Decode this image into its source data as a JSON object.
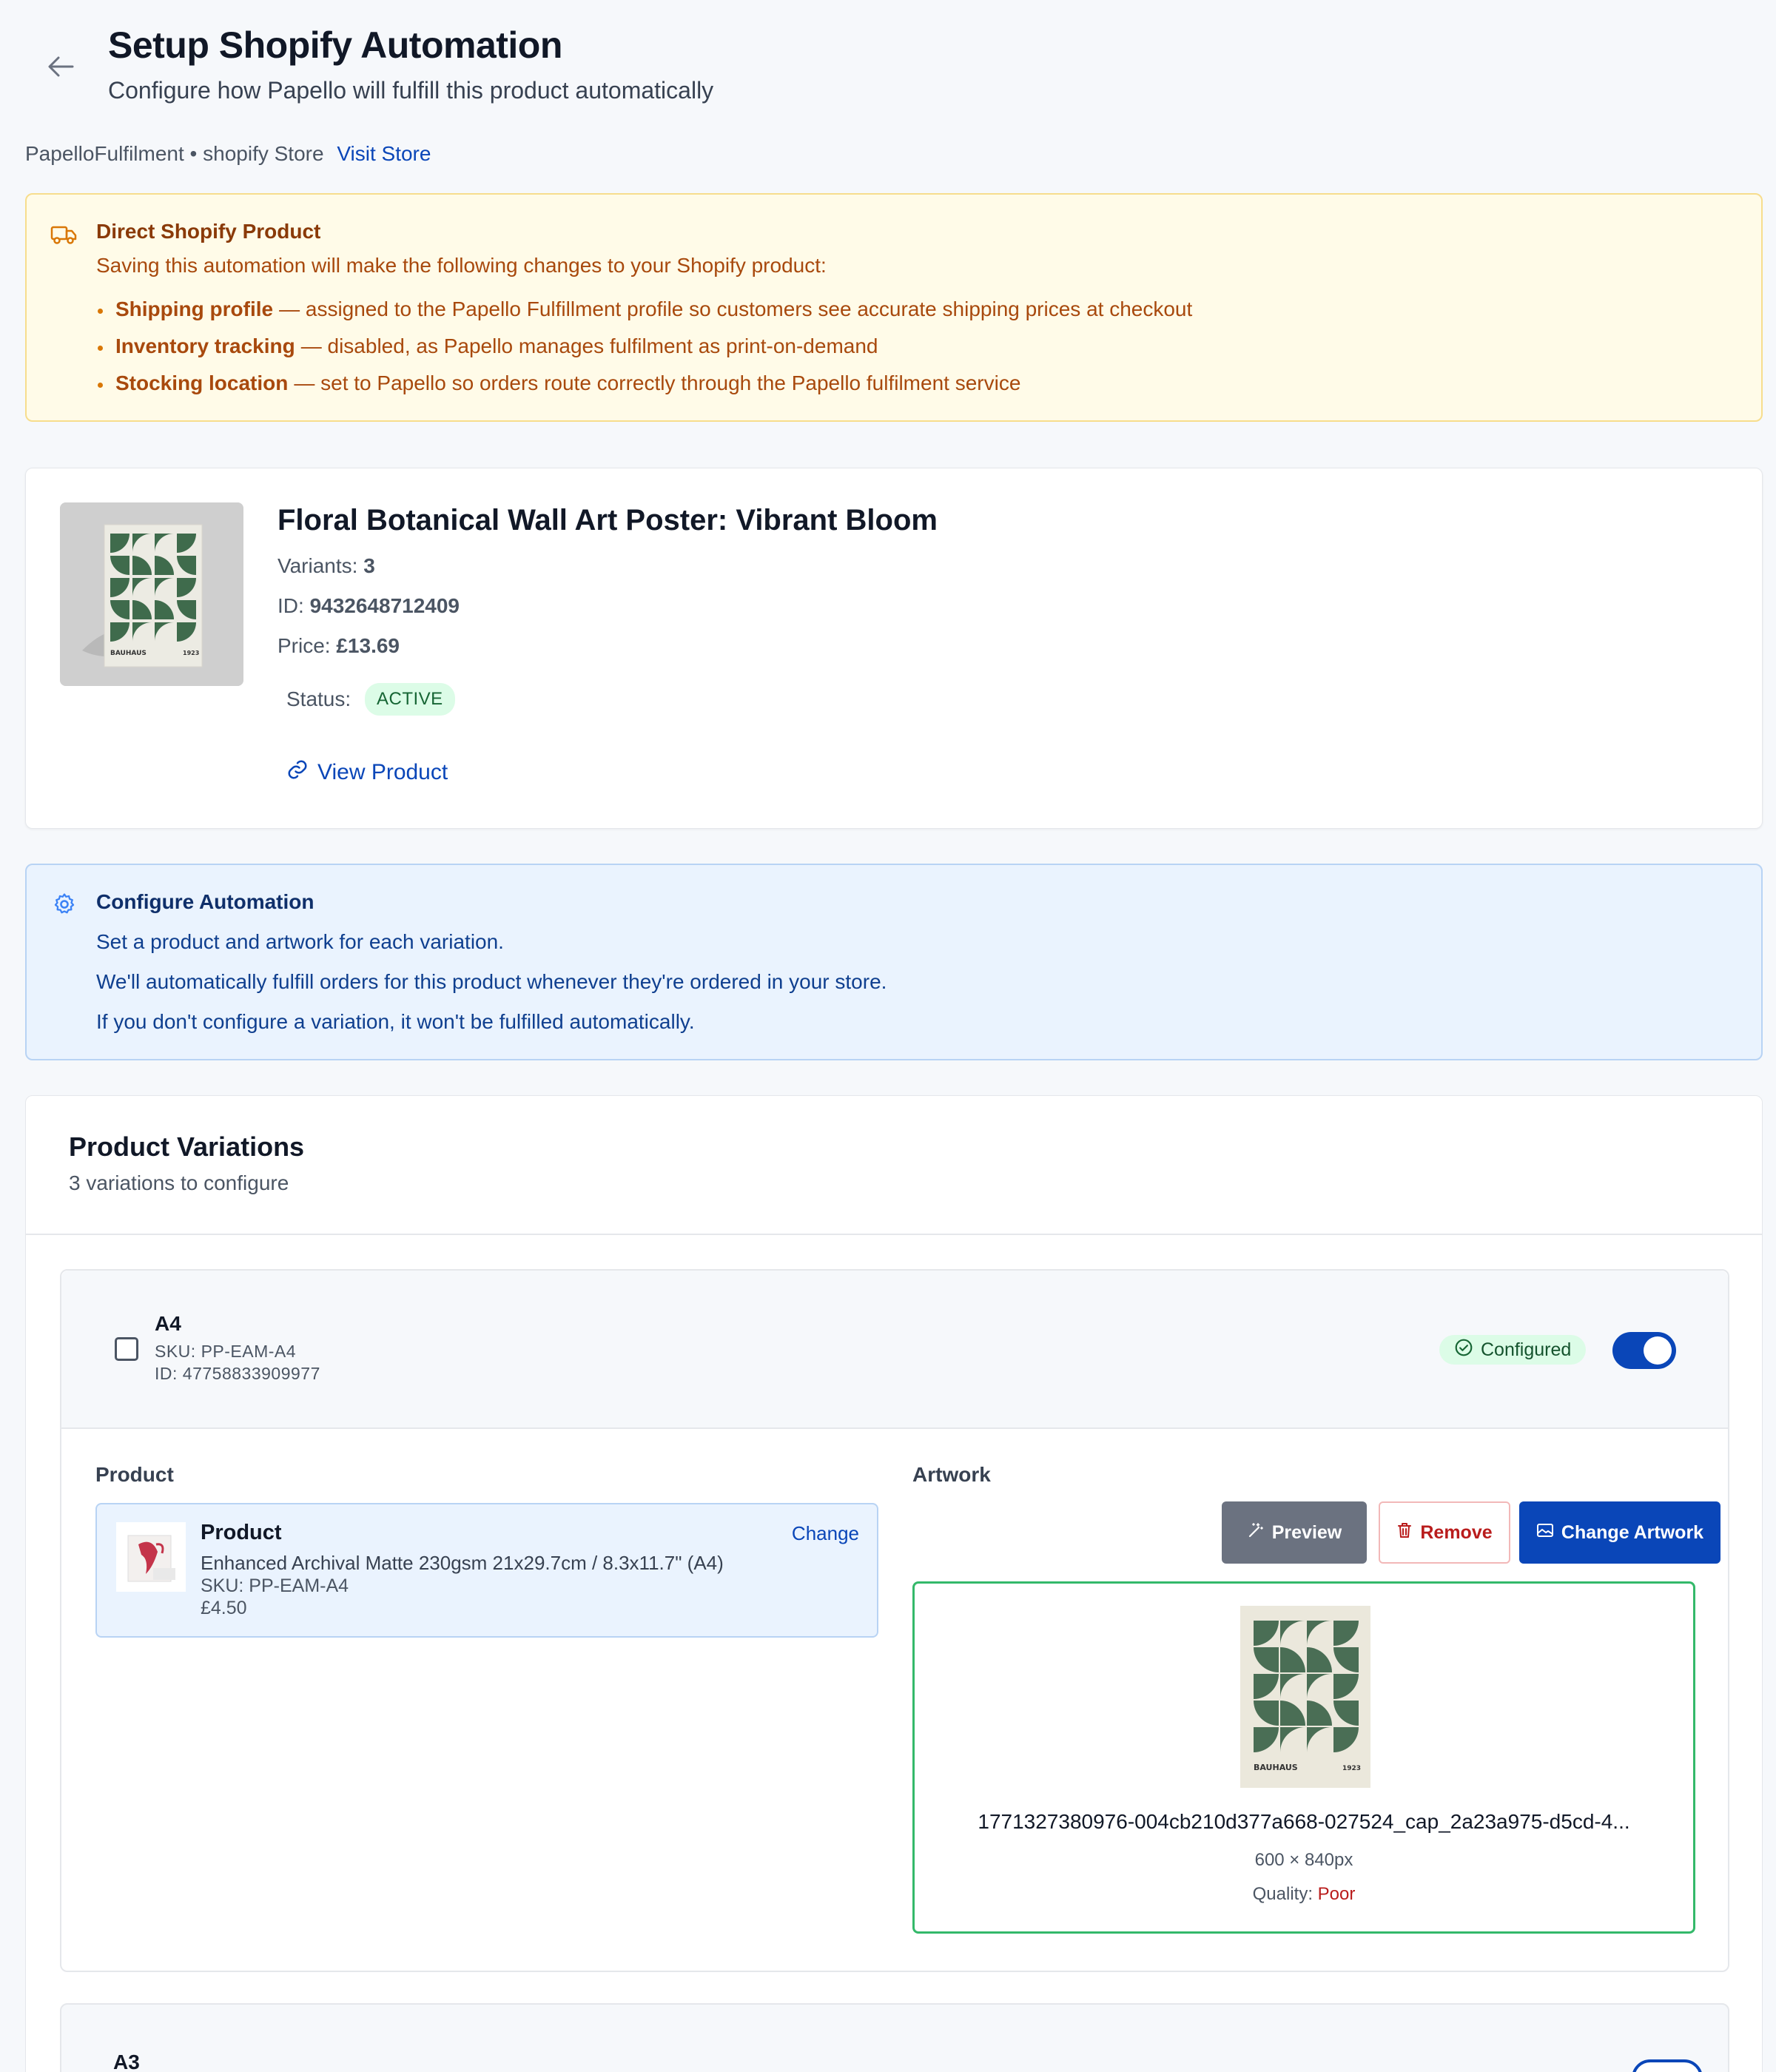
{
  "header": {
    "title": "Setup Shopify Automation",
    "subtitle": "Configure how Papello will fulfill this product automatically"
  },
  "store": {
    "text": "PapelloFulfilment • shopify Store",
    "visit_label": "Visit Store"
  },
  "warning": {
    "title": "Direct Shopify Product",
    "description": "Saving this automation will make the following changes to your Shopify product:",
    "items": [
      {
        "label": "Shipping profile",
        "text": "— assigned to the Papello Fulfillment profile so customers see accurate shipping prices at checkout"
      },
      {
        "label": "Inventory tracking",
        "text": "— disabled, as Papello manages fulfilment as print-on-demand"
      },
      {
        "label": "Stocking location",
        "text": "— set to Papello so orders route correctly through the Papello fulfilment service"
      }
    ]
  },
  "product": {
    "title": "Floral Botanical Wall Art Poster: Vibrant Bloom",
    "variants_label": "Variants:",
    "variants_value": "3",
    "id_label": "ID:",
    "id_value": "9432648712409",
    "price_label": "Price:",
    "price_value": "£13.69",
    "status_label": "Status:",
    "status_value": "ACTIVE",
    "view_label": "View Product",
    "thumb_text_left": "BAUHAUS",
    "thumb_text_right": "1923"
  },
  "info": {
    "title": "Configure Automation",
    "lines": [
      "Set a product and artwork for each variation.",
      "We'll automatically fulfill orders for this product whenever they're ordered in your store.",
      "If you don't configure a variation, it won't be fulfilled automatically."
    ]
  },
  "variations": {
    "title": "Product Variations",
    "subtitle": "3 variations to configure",
    "items": [
      {
        "name": "A4",
        "sku": "SKU: PP-EAM-A4",
        "id": "ID: 47758833909977",
        "status": "Configured",
        "enabled": true,
        "product_label": "Product",
        "artwork_label": "Artwork",
        "product": {
          "name": "Product",
          "description": "Enhanced Archival Matte 230gsm 21x29.7cm / 8.3x11.7\" (A4)",
          "sku": "SKU: PP-EAM-A4",
          "price": "£4.50",
          "change_label": "Change"
        },
        "buttons": {
          "preview": "Preview",
          "remove": "Remove",
          "change_artwork": "Change Artwork"
        },
        "artwork": {
          "filename": "1771327380976-004cb210d377a668-027524_cap_2a23a975-d5cd-4...",
          "dimensions": "600 × 840px",
          "quality_label": "Quality:",
          "quality_value": "Poor",
          "thumb_text_left": "BAUHAUS",
          "thumb_text_right": "1923"
        }
      },
      {
        "name": "A3"
      }
    ]
  },
  "colors": {
    "primary": "#0a46b8",
    "warning_bg": "#fffbe8",
    "info_bg": "#eaf3fe",
    "success": "#34b96a",
    "danger": "#b91c1c"
  }
}
